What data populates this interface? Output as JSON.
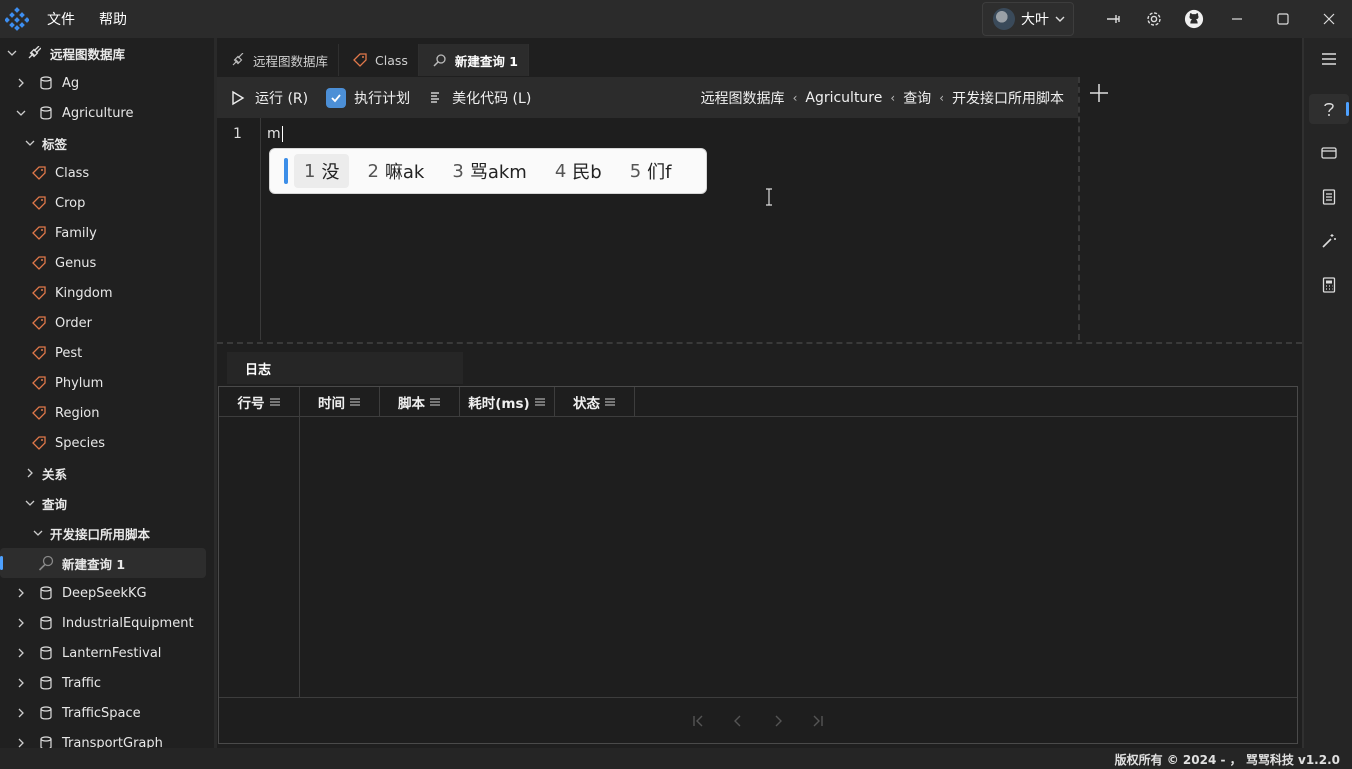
{
  "menu": {
    "file": "文件",
    "help": "帮助"
  },
  "user": {
    "name": "大叶"
  },
  "sidebar": {
    "root": "远程图数据库",
    "items": [
      {
        "label": "Ag"
      },
      {
        "label": "Agriculture"
      },
      {
        "label": "标签"
      },
      {
        "label": "Class"
      },
      {
        "label": "Crop"
      },
      {
        "label": "Family"
      },
      {
        "label": "Genus"
      },
      {
        "label": "Kingdom"
      },
      {
        "label": "Order"
      },
      {
        "label": "Pest"
      },
      {
        "label": "Phylum"
      },
      {
        "label": "Region"
      },
      {
        "label": "Species"
      },
      {
        "label": "关系"
      },
      {
        "label": "查询"
      },
      {
        "label": "开发接口所用脚本"
      },
      {
        "label": "新建查询 1"
      },
      {
        "label": "DeepSeekKG"
      },
      {
        "label": "IndustrialEquipment"
      },
      {
        "label": "LanternFestival"
      },
      {
        "label": "Traffic"
      },
      {
        "label": "TrafficSpace"
      },
      {
        "label": "TransportGraph"
      }
    ]
  },
  "tabs": [
    {
      "label": "远程图数据库"
    },
    {
      "label": "Class"
    },
    {
      "label": "新建查询 1"
    }
  ],
  "toolbar": {
    "run": "运行 (R)",
    "plan": "执行计划",
    "beautify": "美化代码 (L)"
  },
  "breadcrumb": [
    "远程图数据库",
    "Agriculture",
    "查询",
    "开发接口所用脚本"
  ],
  "editor": {
    "line": "1",
    "code": "m"
  },
  "ime": [
    {
      "n": "1",
      "text": "没"
    },
    {
      "n": "2",
      "text": "嘛ak"
    },
    {
      "n": "3",
      "text": "骂akm"
    },
    {
      "n": "4",
      "text": "民b"
    },
    {
      "n": "5",
      "text": "们f"
    }
  ],
  "log": {
    "tab": "日志",
    "columns": [
      "行号",
      "时间",
      "脚本",
      "耗时(ms)",
      "状态"
    ]
  },
  "status": {
    "copyright": "版权所有 © 2024 - ， 骂骂科技   v1.2.0"
  },
  "colors": {
    "accent": "#4ea1ff",
    "checkbox": "#4c8fd6",
    "tag": "#e0784a"
  }
}
